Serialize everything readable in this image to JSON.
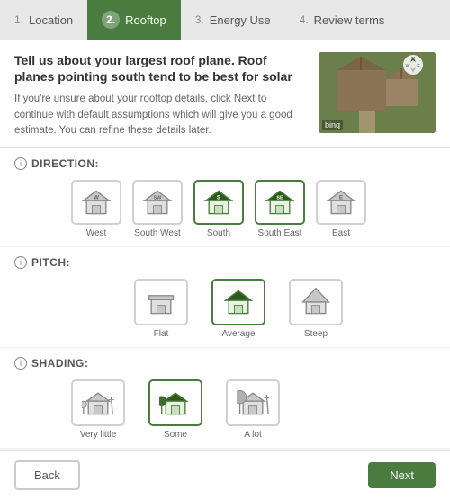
{
  "stepper": {
    "steps": [
      {
        "num": "1.",
        "label": "Location",
        "active": false
      },
      {
        "num": "2.",
        "label": "Rooftop",
        "active": true
      },
      {
        "num": "3.",
        "label": "Energy Use",
        "active": false
      },
      {
        "num": "4.",
        "label": "Review terms",
        "active": false
      }
    ]
  },
  "header": {
    "title": "Tell us about your largest roof plane. Roof planes pointing south tend to be best for solar",
    "description": "If you're unsure about your rooftop details, click Next to continue with default assumptions which will give you a good estimate. You can refine these details later."
  },
  "sections": {
    "direction": {
      "title": "DIRECTION:",
      "options": [
        {
          "label": "West",
          "selected": false
        },
        {
          "label": "South West",
          "selected": false
        },
        {
          "label": "South",
          "selected": true
        },
        {
          "label": "South East",
          "selected": true
        },
        {
          "label": "East",
          "selected": false
        }
      ]
    },
    "pitch": {
      "title": "PITCH:",
      "options": [
        {
          "label": "Flat",
          "selected": false
        },
        {
          "label": "Average",
          "selected": true
        },
        {
          "label": "Steep",
          "selected": false
        }
      ]
    },
    "shading": {
      "title": "SHADING:",
      "options": [
        {
          "label": "Very little",
          "selected": false
        },
        {
          "label": "Some",
          "selected": true
        },
        {
          "label": "A lot",
          "selected": false
        }
      ]
    }
  },
  "buttons": {
    "back": "Back",
    "next": "Next"
  },
  "compass_labels": [
    "N",
    "E",
    "W"
  ],
  "bing": "bing"
}
